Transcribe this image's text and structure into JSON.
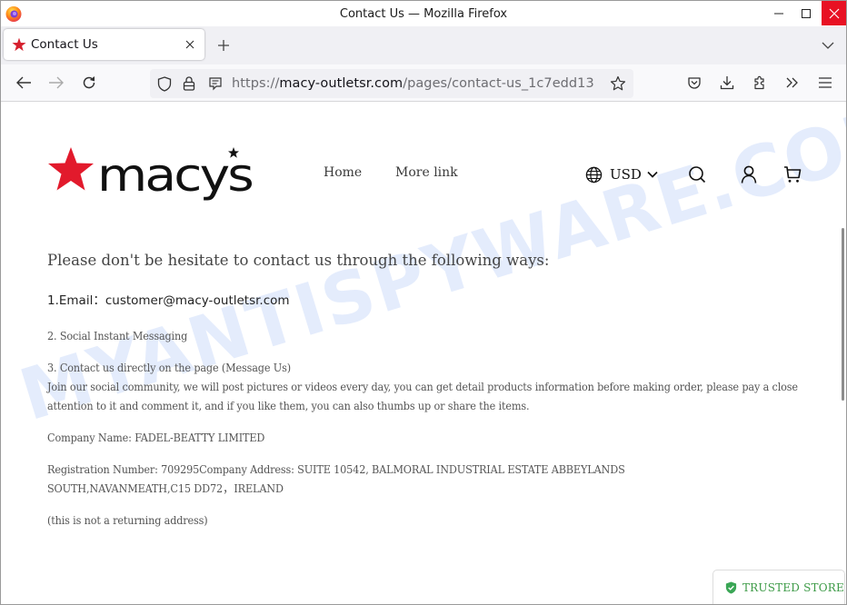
{
  "browser": {
    "window_title": "Contact Us — Mozilla Firefox",
    "tab": {
      "title": "Contact Us",
      "favicon": "red-star-icon"
    },
    "url": {
      "scheme": "https://",
      "host": "macy-outletsr.com",
      "path": "/pages/contact-us_1c7edd13"
    },
    "icons": [
      "firefox-logo",
      "minimize-icon",
      "maximize-icon",
      "close-icon",
      "tab-close-icon",
      "new-tab-icon",
      "list-all-tabs-icon",
      "back-icon",
      "forward-icon",
      "reload-icon",
      "shield-icon",
      "lock-icon",
      "reader-view-icon",
      "bookmark-star-icon",
      "pocket-icon",
      "download-icon",
      "extensions-icon",
      "overflow-icon",
      "menu-icon"
    ]
  },
  "site": {
    "logo_text": "macys",
    "nav": [
      {
        "label": "Home"
      },
      {
        "label": "More link"
      }
    ],
    "currency": "USD",
    "header_icons": [
      "globe-icon",
      "chevron-down-icon",
      "search-icon",
      "account-icon",
      "cart-icon"
    ],
    "colors": {
      "brand_red": "#e21a2c",
      "trusted_green": "#3c9a46"
    }
  },
  "content": {
    "headline": "Please don't be hesitate to contact us through the following ways:",
    "email_line": "1.Email：customer@macy-outletsr.com",
    "social": "2. Social Instant Messaging",
    "contact_direct": "3. Contact us directly on the page (Message Us)",
    "community": "Join our social community, we will post pictures or videos every day, you can get detail products information before making order, please pay a close attention to it and comment it, and if you like them, you can also thumbs up or share the items.",
    "company_name": "Company Name: FADEL-BEATTY LIMITED",
    "registration": "Registration Number: 709295Company Address: SUITE 10542, BALMORAL INDUSTRIAL ESTATE ABBEYLANDS SOUTH,NAVANMEATH,C15 DD72，IRELAND",
    "note": "(this is not a returning address)"
  },
  "badge": {
    "label": "TRUSTED STORE",
    "icon": "shield-check-icon"
  },
  "watermark": "MYANTISPYWARE.COM"
}
